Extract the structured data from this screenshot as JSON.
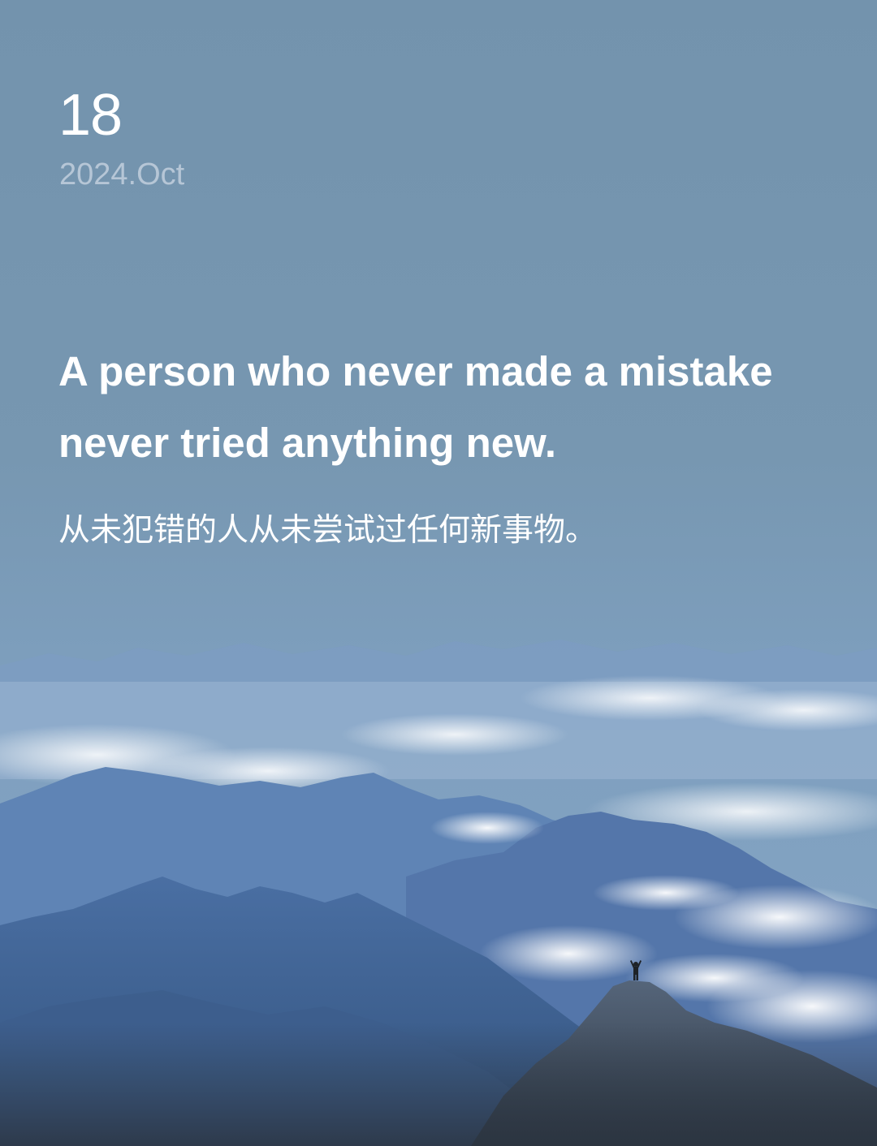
{
  "card": {
    "day": "18",
    "month_year": "2024.Oct",
    "quote_en": "A person who never made a mistake never tried anything new.",
    "quote_cn": "从未犯错的人从未尝试过任何新事物。"
  },
  "colors": {
    "sky_top": "#7393ad",
    "sky_bottom": "#86a6c6",
    "date_secondary": "#b6c6d6",
    "text_primary": "#ffffff",
    "mountain_far": "#6f93be",
    "mountain_mid": "#4f73a6",
    "mountain_near": "#3b5f8f",
    "peak_dark": "#3f4a55"
  },
  "background": {
    "scene": "mountain-range-with-clouds",
    "figure": "person-on-summit-arms-raised"
  }
}
